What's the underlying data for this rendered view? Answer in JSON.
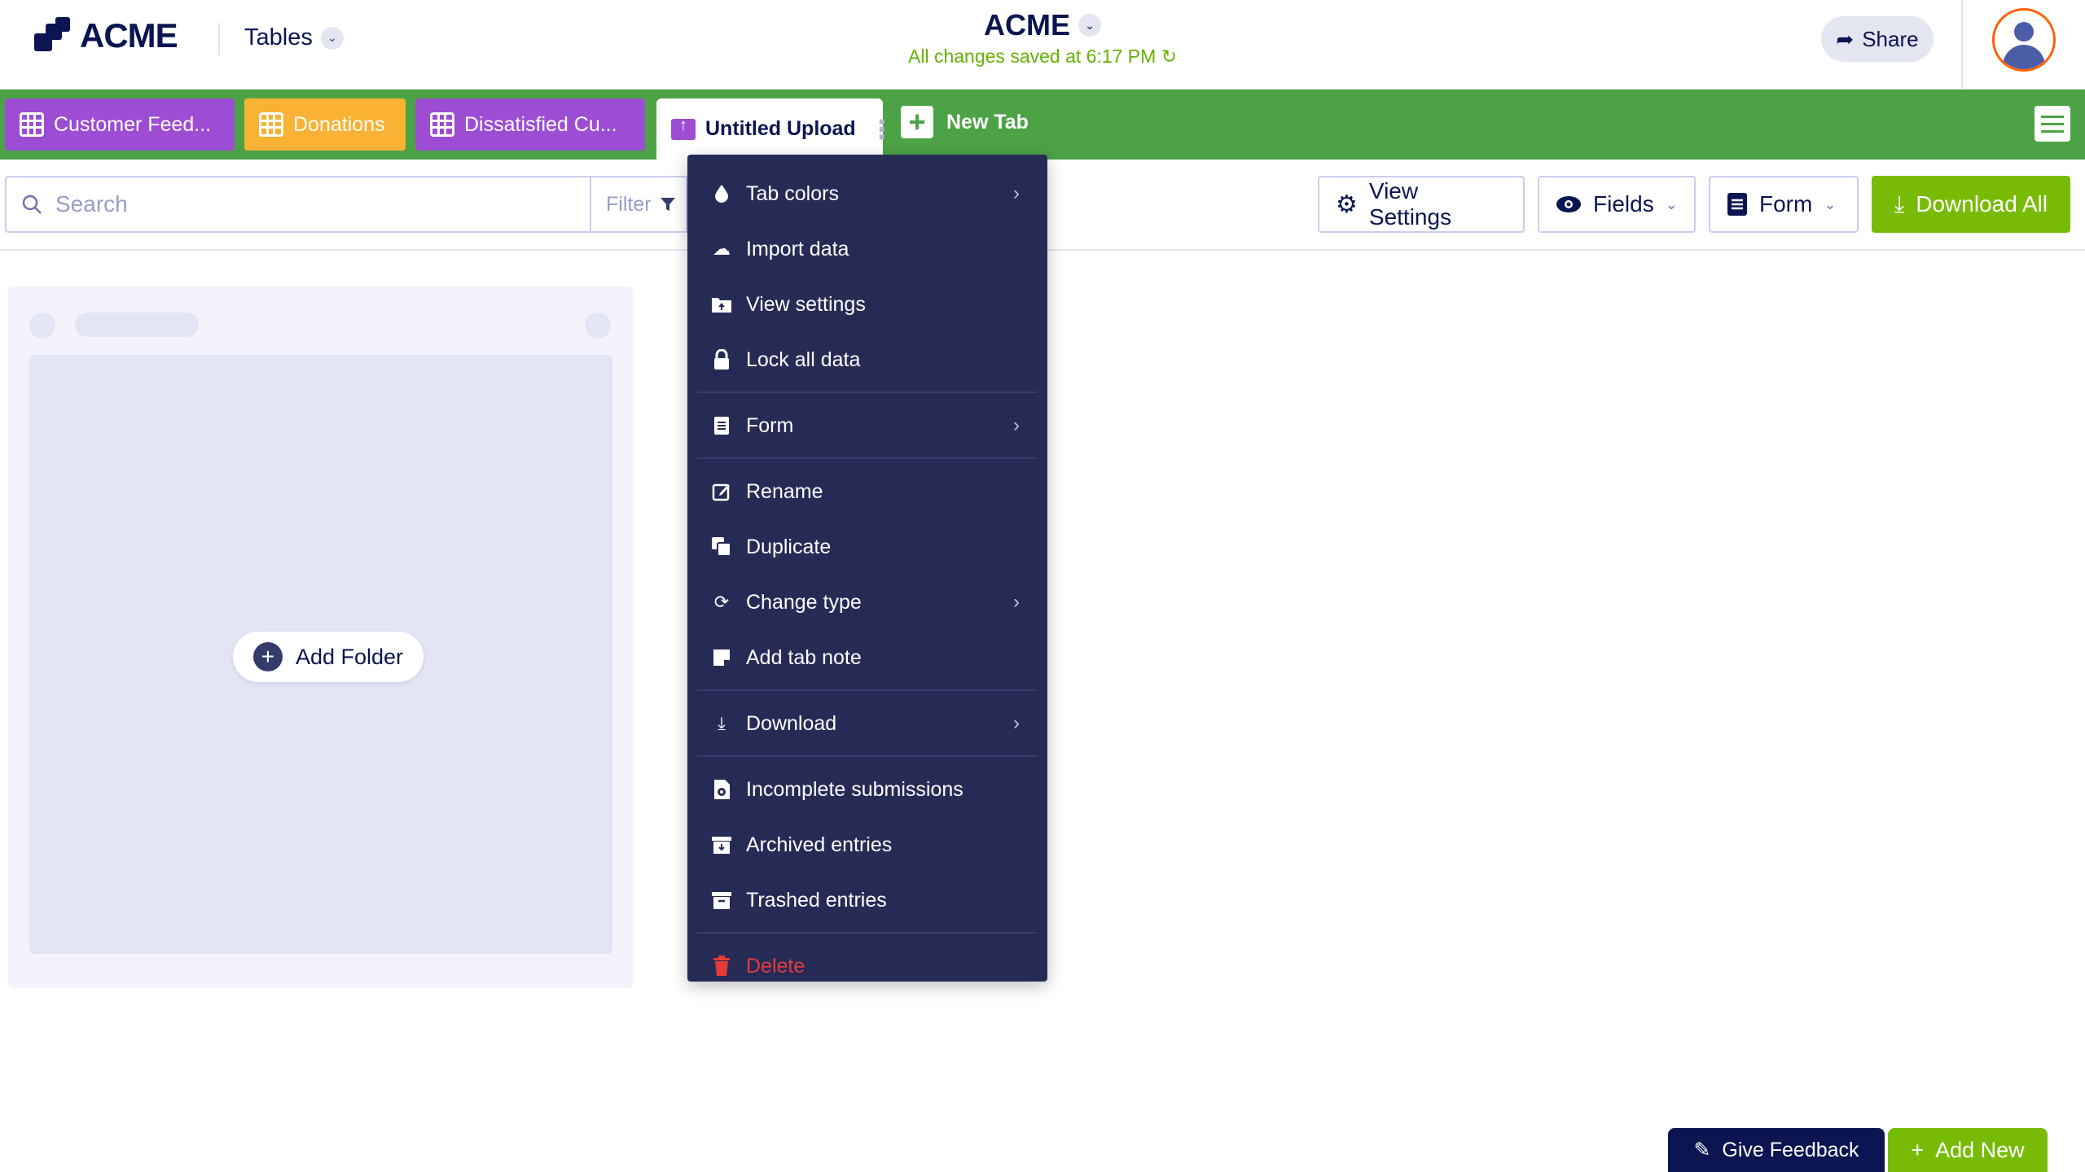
{
  "header": {
    "logo_text": "ACME",
    "product_dropdown": "Tables",
    "app_name": "ACME",
    "save_status": "All changes saved at 6:17 PM",
    "share_label": "Share"
  },
  "tabs": [
    {
      "label": "Customer Feed...",
      "color": "#9c4dd3"
    },
    {
      "label": "Donations",
      "color": "#f9b234"
    },
    {
      "label": "Dissatisfied Cu...",
      "color": "#9c4dd3"
    },
    {
      "label": "Untitled Upload",
      "color": "#ffffff"
    }
  ],
  "new_tab_label": "New Tab",
  "toolbar": {
    "search_placeholder": "Search",
    "filter_label": "Filter",
    "view_settings_label": "View Settings",
    "fields_label": "Fields",
    "form_label": "Form",
    "download_all_label": "Download All"
  },
  "board": {
    "add_folder_label": "Add Folder"
  },
  "context_menu": {
    "items": [
      {
        "label": "Tab colors",
        "icon": "drop-icon"
      },
      {
        "label": "Import data",
        "icon": "cloud-upload-icon"
      },
      {
        "label": "View settings",
        "icon": "folder-upload-icon"
      },
      {
        "label": "Lock all data",
        "icon": "lock-icon"
      },
      {
        "label": "Form",
        "icon": "document-icon"
      },
      {
        "label": "Rename",
        "icon": "edit-icon"
      },
      {
        "label": "Duplicate",
        "icon": "copy-icon"
      },
      {
        "label": "Change type",
        "icon": "refresh-icon"
      },
      {
        "label": "Add tab note",
        "icon": "note-icon"
      },
      {
        "label": "Download",
        "icon": "download-icon"
      },
      {
        "label": "Incomplete submissions",
        "icon": "clock-file-icon"
      },
      {
        "label": "Archived entries",
        "icon": "archive-icon"
      },
      {
        "label": "Trashed entries",
        "icon": "trash-box-icon"
      },
      {
        "label": "Delete",
        "icon": "trash-icon"
      }
    ]
  },
  "footer": {
    "feedback_label": "Give Feedback",
    "add_new_label": "Add New"
  },
  "colors": {
    "tabbar_bg": "#4ca245",
    "menu_bg": "#262b56",
    "accent_green": "#78bb07",
    "danger": "#e43b3b",
    "brand_navy": "#0a1551"
  }
}
